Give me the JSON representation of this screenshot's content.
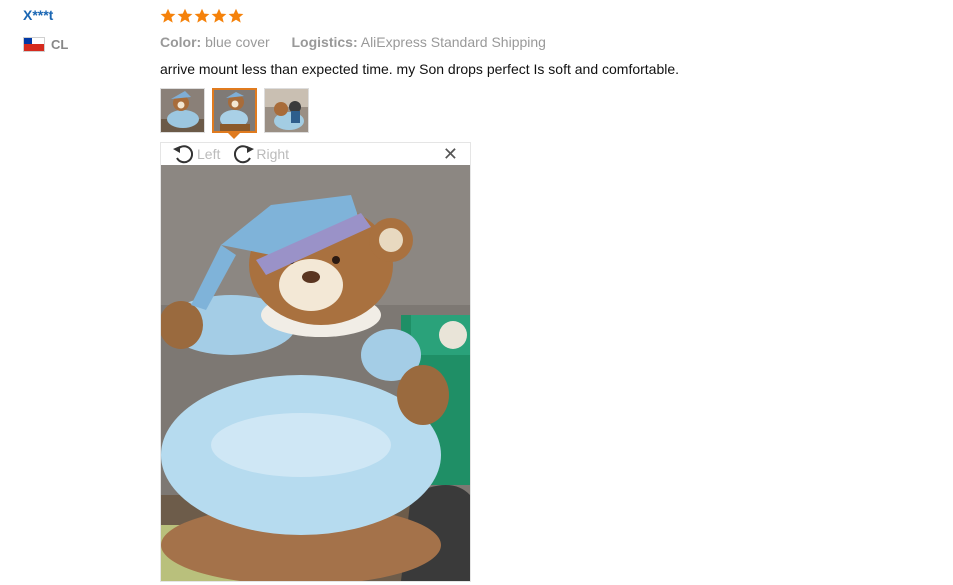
{
  "reviewer": {
    "name": "X***t",
    "country_code": "CL",
    "flag_icon": "chile-flag-icon"
  },
  "review": {
    "rating": 5,
    "rating_color": "#f5820b",
    "attributes": [
      {
        "label": "Color:",
        "value": "blue cover"
      },
      {
        "label": "Logistics:",
        "value": "AliExpress Standard Shipping"
      }
    ],
    "text": "arrive mount less than expected time. my Son drops perfect Is soft and comfortable.",
    "thumbnails": [
      {
        "icon": "review-photo-thumbnail",
        "selected": false
      },
      {
        "icon": "review-photo-thumbnail",
        "selected": true
      },
      {
        "icon": "review-photo-thumbnail",
        "selected": false
      }
    ]
  },
  "viewer": {
    "rotate_left_label": "Left",
    "rotate_right_label": "Right",
    "close_icon": "close-icon",
    "accent_color": "#e07b1f"
  }
}
